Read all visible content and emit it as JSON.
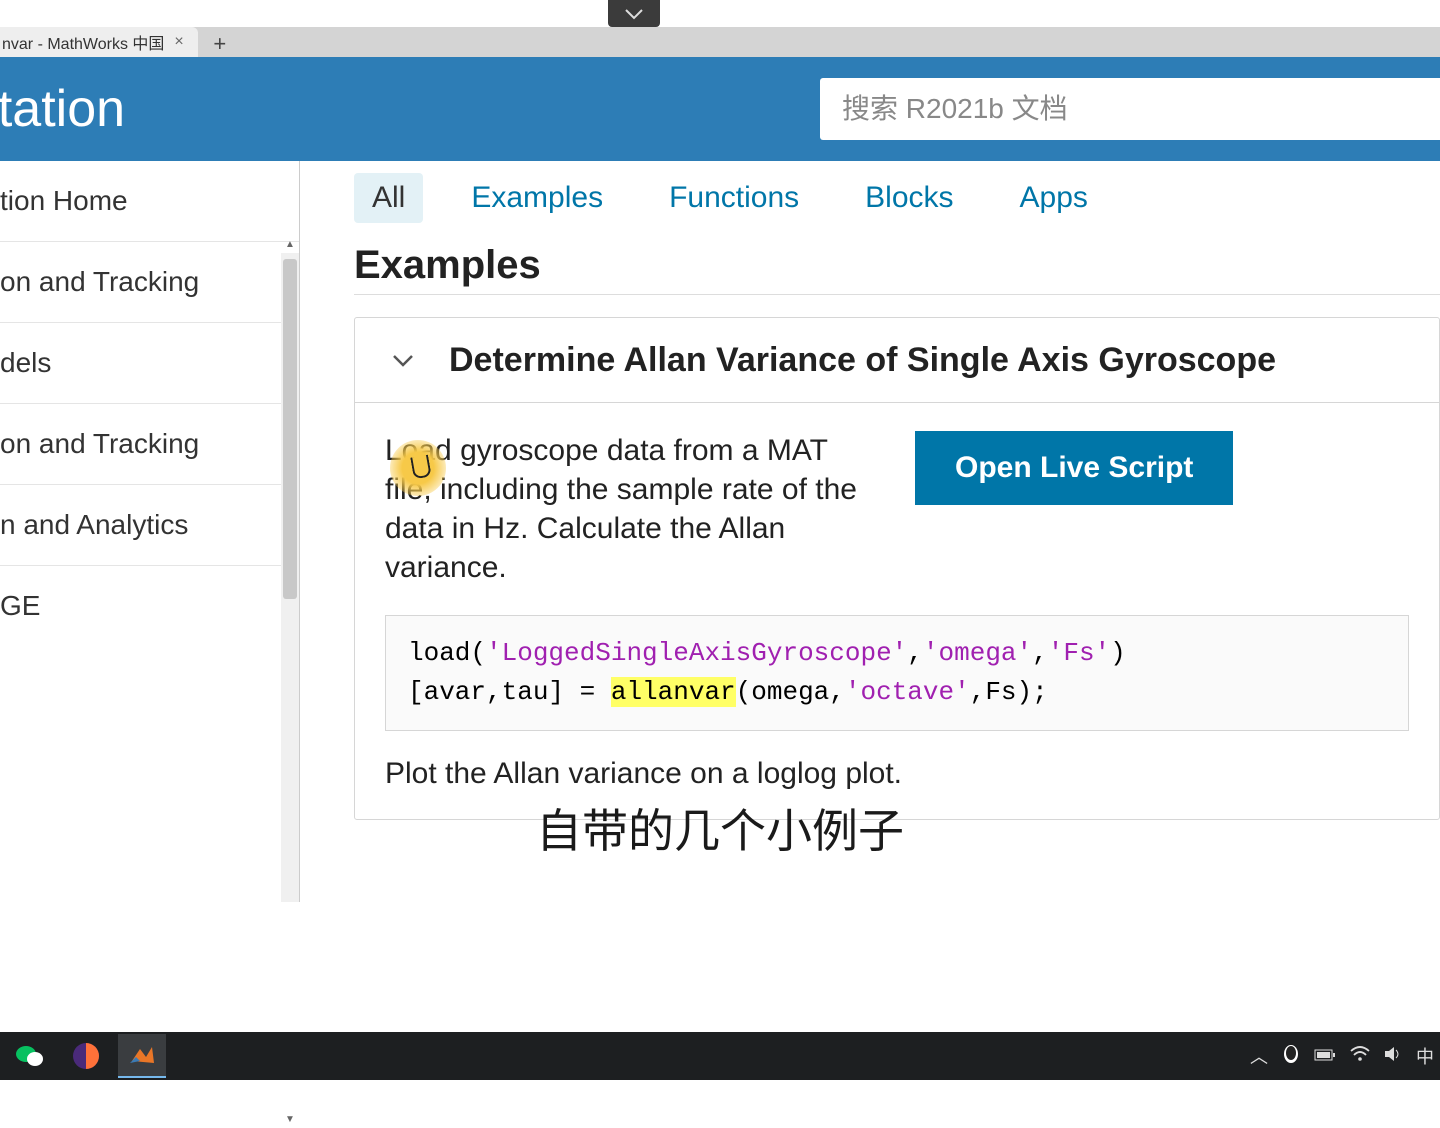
{
  "browser": {
    "tab_title": "nvar - MathWorks 中国",
    "new_tab": "+"
  },
  "header": {
    "title": "entation",
    "search_placeholder": "搜索 R2021b 文档"
  },
  "sidebar": {
    "items": [
      "tion Home",
      "on and Tracking",
      "dels",
      "on and Tracking",
      "n and Analytics",
      "GE"
    ]
  },
  "tabs": {
    "all": "All",
    "examples": "Examples",
    "functions": "Functions",
    "blocks": "Blocks",
    "apps": "Apps"
  },
  "main": {
    "section_heading": "Examples",
    "example_title": "Determine Allan Variance of Single Axis Gyroscope",
    "example_desc": "Load gyroscope data from a MAT file, including the sample rate of the data in Hz. Calculate the Allan variance.",
    "open_live": "Open Live Script",
    "code": {
      "p1": "load(",
      "s1": "'LoggedSingleAxisGyroscope'",
      "p2": ",",
      "s2": "'omega'",
      "p3": ",",
      "s3": "'Fs'",
      "p4": ")",
      "p5": "[avar,tau] = ",
      "hl": "allanvar",
      "p6": "(omega,",
      "s4": "'octave'",
      "p7": ",Fs);"
    },
    "post_code": "Plot the Allan variance on a loglog plot."
  },
  "subtitle": "自带的几个小例子",
  "systray": {
    "ime": "中"
  }
}
